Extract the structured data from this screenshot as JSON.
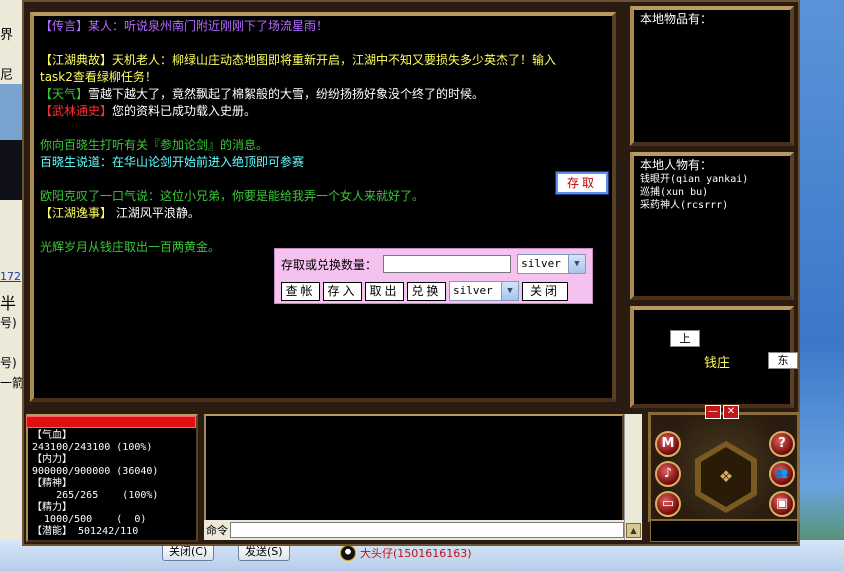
{
  "background": {
    "fragments": [
      "界",
      "尼",
      "172",
      "半",
      "号)",
      "号)",
      "一箭"
    ]
  },
  "chat": {
    "lines": [
      {
        "tag": "【传言】",
        "text": "某人：听说泉州南门附近刚刚下了场流星雨！",
        "tag_color": "purple",
        "text_color": "purple"
      },
      {
        "gap": true
      },
      {
        "tag": "【江湖典故】",
        "text": "天机老人：柳绿山庄动态地图即将重新开启，江湖中不知又要损失多少英杰了！输入",
        "tag_color": "yellow",
        "text_color": "yellow"
      },
      {
        "tag": "",
        "text": "task2查看绿柳任务！",
        "tag_color": "yellow",
        "text_color": "yellow"
      },
      {
        "tag": "【天气】",
        "text": "雪越下越大了，竟然飘起了棉絮般的大雪，纷纷扬扬好象没个终了的时候。",
        "tag_color": "green",
        "text_color": "white"
      },
      {
        "tag": "【武林通史】",
        "text": "您的资料已成功载入史册。",
        "tag_color": "red",
        "text_color": "white"
      },
      {
        "gap": true
      },
      {
        "tag": "",
        "text": "你向百晓生打听有关『参加论剑』的消息。",
        "tag_color": "green",
        "text_color": "green"
      },
      {
        "tag": "",
        "text": "百晓生说道：在华山论剑开始前进入绝顶即可参赛",
        "tag_color": "cyan",
        "text_color": "cyan"
      },
      {
        "gap": true
      },
      {
        "tag": "",
        "text": "欧阳克叹了一口气说：这位小兄弟，你要是能给我弄一个女人来就好了。",
        "tag_color": "green",
        "text_color": "green"
      },
      {
        "tag": "【江湖逸事】",
        "text": " 江湖风平浪静。",
        "tag_color": "yellow",
        "text_color": "white"
      },
      {
        "gap": true
      },
      {
        "tag": "",
        "text": "光辉岁月从钱庄取出一百两黄金。",
        "tag_color": "green",
        "text_color": "green"
      }
    ],
    "store_button": "存取"
  },
  "dialog": {
    "label": "存取或兑换数量：",
    "amount_value": "",
    "currency_selected": "silver",
    "buttons": {
      "check": "查帐",
      "deposit": "存入",
      "withdraw": "取出",
      "exchange": "兑换",
      "close": "关闭"
    },
    "exchange_currency": "silver"
  },
  "items_panel": {
    "title": "本地物品有："
  },
  "people_panel": {
    "title": "本地人物有：",
    "people": [
      "钱眼开(qian yankai)",
      "巡捕(xun bu)",
      "采药神人(rcsrrr)"
    ]
  },
  "map_panel": {
    "north": "上",
    "location": "钱庄",
    "east": "东"
  },
  "status": {
    "hp_label": "【气血】",
    "hp_value": "243100/243100 (100%)",
    "neili_label": "【内力】",
    "neili_value": "900000/900000 (36040)",
    "jingshen_label": "【精神】",
    "jingshen_value": "    265/265    (100%)",
    "jingli_label": "【精力】",
    "jingli_value": "  1000/500    (  0)",
    "qianneng_label": "【潜能】",
    "qianneng_value": " 501242/110"
  },
  "command": {
    "label": "命令",
    "value": ""
  },
  "controls": {
    "minimize": "—",
    "close": "✕",
    "orbs": {
      "m": "M",
      "help": "?",
      "music": "♪",
      "people": "👥",
      "list": "▭",
      "screen": "▣"
    }
  },
  "taskbar": {
    "close_button": "关闭(C)",
    "send_button": "发送(S)",
    "qq_text": "大头仔(1501616163)"
  },
  "colors": {
    "purple": "#b26cff",
    "yellow": "#ffff60",
    "white": "#ffffff",
    "red": "#ff3030",
    "green": "#38c838",
    "cyan": "#60ffff"
  }
}
